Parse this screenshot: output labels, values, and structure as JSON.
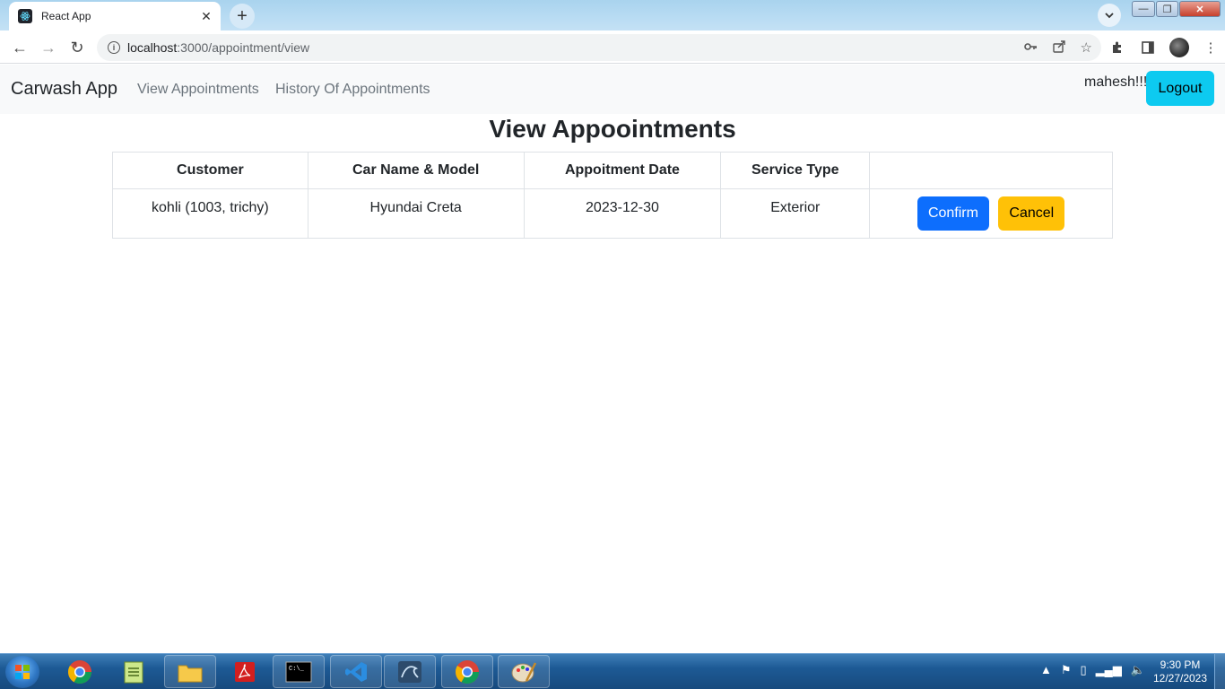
{
  "browser": {
    "tab_title": "React App",
    "url_host": "localhost",
    "url_path": ":3000/appointment/view",
    "icons": [
      "back-icon",
      "forward-icon",
      "reload-icon",
      "info-icon",
      "key-icon",
      "share-icon",
      "star-icon",
      "extensions-icon",
      "sidepanel-icon",
      "profile-avatar",
      "menu-icon"
    ]
  },
  "navbar": {
    "brand": "Carwash App",
    "links": [
      {
        "label": "View Appointments"
      },
      {
        "label": "History Of Appointments"
      }
    ],
    "username": "mahesh!!!",
    "logout_label": "Logout"
  },
  "page": {
    "title": "View Appoointments"
  },
  "table": {
    "headers": [
      "Customer",
      "Car Name & Model",
      "Appoitment Date",
      "Service Type",
      ""
    ],
    "rows": [
      {
        "customer": "kohli (1003, trichy)",
        "car": "Hyundai Creta",
        "date": "2023-12-30",
        "service": "Exterior",
        "confirm_label": "Confirm",
        "cancel_label": "Cancel"
      }
    ]
  },
  "colors": {
    "confirm": "#0d6efd",
    "cancel": "#ffc107",
    "logout": "#0dcaf0",
    "navbar_bg": "#f8f9fa"
  },
  "taskbar": {
    "apps": [
      "chrome-icon",
      "notepad-icon",
      "file-explorer-icon",
      "acrobat-icon",
      "cmd-icon",
      "vscode-icon",
      "mysql-workbench-icon",
      "chrome-icon",
      "paint-icon"
    ],
    "time": "9:30 PM",
    "date": "12/27/2023"
  }
}
